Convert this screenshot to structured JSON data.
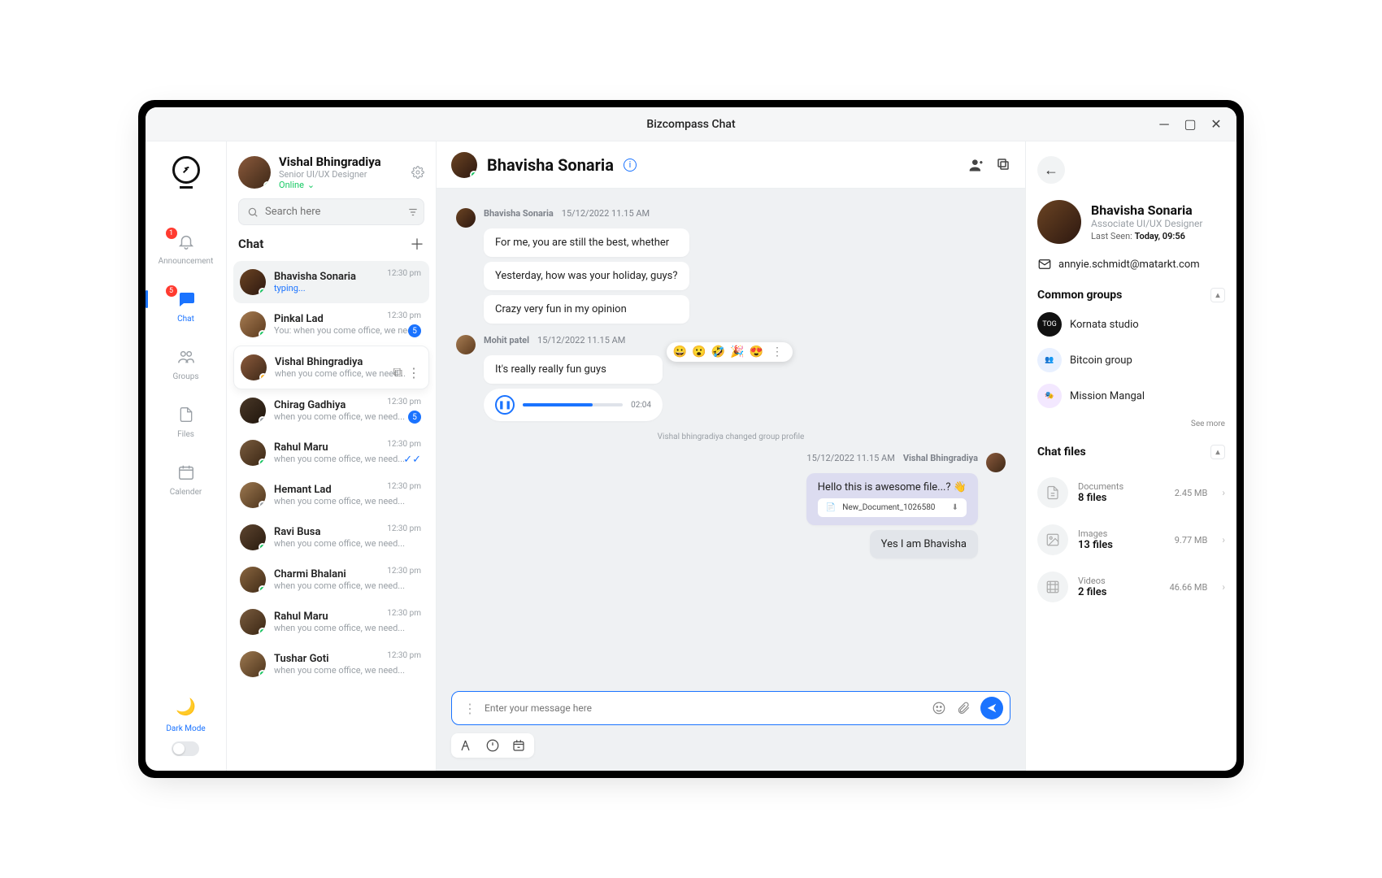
{
  "window": {
    "title": "Bizcompass Chat"
  },
  "rail": {
    "items": [
      {
        "label": "Announcement",
        "badge": "1"
      },
      {
        "label": "Chat",
        "badge": "5",
        "active": true
      },
      {
        "label": "Groups"
      },
      {
        "label": "Files"
      },
      {
        "label": "Calender"
      }
    ],
    "dark_mode_label": "Dark Mode"
  },
  "profile": {
    "name": "Vishal Bhingradiya",
    "role": "Senior UI/UX Designer",
    "status": "Online"
  },
  "search": {
    "placeholder": "Search here"
  },
  "list": {
    "heading": "Chat",
    "items": [
      {
        "name": "Bhavisha Sonaria",
        "sub": "typing...",
        "time": "12:30 pm",
        "typing": true,
        "selected": true,
        "status": "online"
      },
      {
        "name": "Pinkal Lad",
        "sub": "You: when you come office, we need...",
        "time": "12:30 pm",
        "badge": "5",
        "status": "online"
      },
      {
        "name": "Vishal Bhingradiya",
        "sub": "when you come office, we need...",
        "time": "",
        "actions": true,
        "hover": true,
        "status": "away"
      },
      {
        "name": "Chirag Gadhiya",
        "sub": "when you come office, we need...",
        "time": "12:30 pm",
        "badge": "5",
        "status": "off"
      },
      {
        "name": "Rahul Maru",
        "sub": "when you come office, we need...",
        "time": "12:30 pm",
        "check": true,
        "status": "online"
      },
      {
        "name": "Hemant Lad",
        "sub": "when you come office, we need...",
        "time": "12:30 pm",
        "status": "off"
      },
      {
        "name": "Ravi Busa",
        "sub": "when you come office, we need...",
        "time": "12:30 pm",
        "status": "online"
      },
      {
        "name": "Charmi Bhalani",
        "sub": "when you come office, we need...",
        "time": "12:30 pm",
        "status": "online"
      },
      {
        "name": "Rahul Maru",
        "sub": "when you come office, we need...",
        "time": "12:30 pm",
        "status": "online"
      },
      {
        "name": "Tushar Goti",
        "sub": "when you come office, we need...",
        "time": "12:30 pm",
        "status": "online"
      }
    ]
  },
  "chat": {
    "title": "Bhavisha Sonaria",
    "threads": [
      {
        "side": "left",
        "author": "Bhavisha Sonaria",
        "time": "15/12/2022 11.15 AM",
        "bubbles": [
          "For me, you are still the best, whether",
          "Yesterday, how was your holiday, guys?",
          "Crazy very fun in my opinion"
        ]
      },
      {
        "side": "left",
        "author": "Mohit patel",
        "time": "15/12/2022 11.15 AM",
        "bubbles": [
          "It's really really fun guys"
        ],
        "audio": {
          "duration": "02:04"
        },
        "reactions": [
          "😀",
          "😮",
          "🤣",
          "🎉",
          "😍"
        ]
      }
    ],
    "system": "Vishal bhingradiya changed group profile",
    "right_thread": {
      "author": "Vishal Bhingradiya",
      "time": "15/12/2022 11.15 AM",
      "bubble": "Hello this is awesome file...? 👋",
      "file": "New_Document_1026580",
      "reply": "Yes I am Bhavisha"
    },
    "composer_placeholder": "Enter your message here"
  },
  "right": {
    "name": "Bhavisha Sonaria",
    "role": "Associate UI/UX Designer",
    "last_seen_label": "Last Seen:",
    "last_seen_value": "Today, 09:56",
    "email": "annyie.schmidt@matarkt.com",
    "groups_heading": "Common groups",
    "groups": [
      {
        "name": "Kornata studio"
      },
      {
        "name": "Bitcoin group"
      },
      {
        "name": "Mission Mangal"
      }
    ],
    "see_more": "See more",
    "files_heading": "Chat files",
    "files": [
      {
        "title": "Documents",
        "count": "8 files",
        "size": "2.45 MB"
      },
      {
        "title": "Images",
        "count": "13 files",
        "size": "9.77 MB"
      },
      {
        "title": "Videos",
        "count": "2 files",
        "size": "46.66 MB"
      }
    ]
  }
}
